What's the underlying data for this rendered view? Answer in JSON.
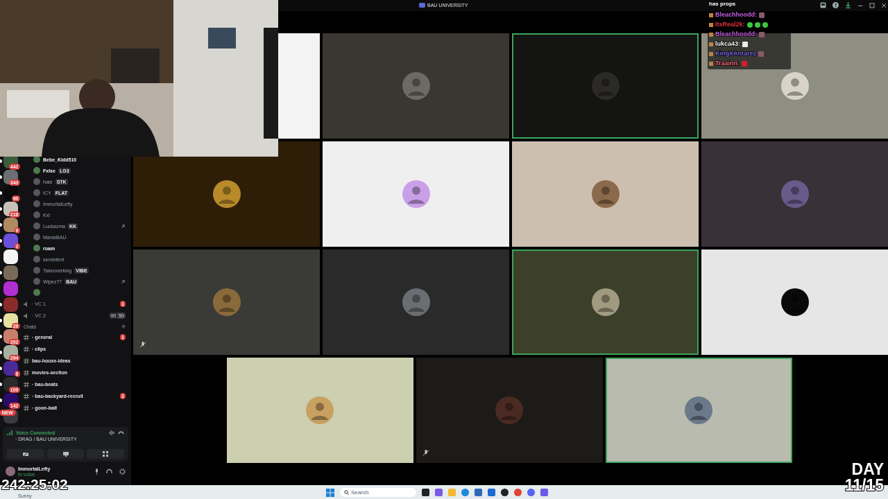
{
  "window": {
    "title": "BAU UNIVERSITY"
  },
  "servers": [
    {
      "badge": "442",
      "unread": true
    },
    {
      "badge": "343",
      "unread": true
    },
    {
      "badge": "90",
      "unread": true
    },
    {
      "badge": "218",
      "unread": true
    },
    {
      "badge": "9",
      "unread": true
    },
    {
      "badge": "2",
      "unread": true
    },
    {
      "unread": false
    },
    {
      "unread": true
    },
    {
      "unread": false
    },
    {
      "unread": true
    },
    {
      "badge": "26",
      "unread": true
    },
    {
      "badge": "202",
      "unread": true
    },
    {
      "badge": "294",
      "unread": true
    },
    {
      "badge": "8",
      "unread": true
    },
    {
      "badge": "109",
      "unread": true
    },
    {
      "badge": "142",
      "unread": true
    },
    {
      "badge": "NEW",
      "unread": false
    }
  ],
  "members": [
    {
      "name": "Bebe_Kidd510",
      "active": true,
      "muted": false
    },
    {
      "name": "Fxlse",
      "tag": "LG3",
      "active": true,
      "muted": false
    },
    {
      "name": "hate",
      "tag": "STK",
      "active": false,
      "muted": false
    },
    {
      "name": "ICY",
      "tag": "FLAT",
      "active": false,
      "muted": false
    },
    {
      "name": "ImmortalLefty",
      "active": false,
      "muted": false
    },
    {
      "name": "Kxl",
      "active": false,
      "muted": false
    },
    {
      "name": "Luckazma",
      "tag": "KK",
      "active": false,
      "muted": true
    },
    {
      "name": "ManieBAU",
      "active": false,
      "muted": false
    },
    {
      "name": "roam",
      "active": true,
      "muted": false
    },
    {
      "name": "servinfent",
      "active": false,
      "muted": false
    },
    {
      "name": "Takeoverking",
      "tag": "VIBE",
      "active": false,
      "muted": false
    },
    {
      "name": "Wipez77",
      "tag": "BAU",
      "active": false,
      "muted": true
    }
  ],
  "voice_channels": [
    {
      "name": "· VC 1",
      "badge": "1"
    },
    {
      "name": "· VC 2",
      "user_count": "00",
      "user_limit": "50"
    }
  ],
  "category": "Chats",
  "text_channels": [
    {
      "name": "· general",
      "badge": "1"
    },
    {
      "name": "· clips"
    },
    {
      "name": "bau-house-ideas"
    },
    {
      "name": "movies-section"
    },
    {
      "name": "· bau-beats"
    },
    {
      "name": "· bau-backyard-recruit",
      "badge": "2"
    },
    {
      "name": "· goon-bait"
    }
  ],
  "voice_panel": {
    "status": "Voice Connected",
    "location": "· DRAG / BAU UNIVERSITY"
  },
  "user_panel": {
    "name": "ImmortalLefty",
    "status": "In voice"
  },
  "tile_rows": [
    [
      {
        "avatar": false,
        "speaking": false,
        "muted": false
      },
      {
        "avatar": true,
        "speaking": false,
        "muted": false
      },
      {
        "avatar": true,
        "speaking": true,
        "muted": false
      },
      {
        "avatar": true,
        "speaking": false,
        "muted": false
      }
    ],
    [
      {
        "avatar": true,
        "speaking": false,
        "muted": false
      },
      {
        "avatar": true,
        "speaking": false,
        "muted": false
      },
      {
        "avatar": true,
        "speaking": false,
        "muted": false
      },
      {
        "avatar": true,
        "speaking": false,
        "muted": false
      }
    ],
    [
      {
        "avatar": true,
        "speaking": false,
        "muted": true
      },
      {
        "avatar": true,
        "speaking": false,
        "muted": false
      },
      {
        "avatar": true,
        "speaking": true,
        "muted": false
      },
      {
        "avatar": true,
        "speaking": false,
        "muted": false
      }
    ],
    [
      {
        "avatar": true,
        "speaking": false,
        "muted": false
      },
      {
        "avatar": true,
        "speaking": false,
        "muted": true
      },
      {
        "avatar": true,
        "speaking": true,
        "muted": false
      }
    ]
  ],
  "chat_overlay": {
    "title": "has props",
    "messages": [
      {
        "user": "Bleachhoodd:",
        "color": "#c45ce0",
        "emotes": [
          {
            "kind": "portrait"
          }
        ]
      },
      {
        "user": "ItsReal2k:",
        "color": "#e0323c",
        "emotes": [
          {
            "kind": "frog"
          },
          {
            "kind": "frog"
          },
          {
            "kind": "frog"
          }
        ]
      },
      {
        "user": "Bleachhoodd:",
        "color": "#c45ce0",
        "emotes": [
          {
            "kind": "portrait"
          }
        ]
      },
      {
        "user": "lukca43:",
        "color": "#ffffff",
        "emotes": [
          {
            "kind": "ghost"
          }
        ]
      },
      {
        "user": "KingXAntarez",
        "color": "#7a6ae8",
        "emotes": [
          {
            "kind": "portrait"
          }
        ]
      },
      {
        "user": "Traainn:",
        "color": "#ff6b82",
        "emotes": [
          {
            "kind": "flag"
          }
        ]
      }
    ]
  },
  "stream_overlay": {
    "timer": "242:25:02",
    "day_label": "DAY",
    "day_count": "11/15"
  },
  "taskbar": {
    "search_placeholder": "Search",
    "weather": "Sunny"
  }
}
